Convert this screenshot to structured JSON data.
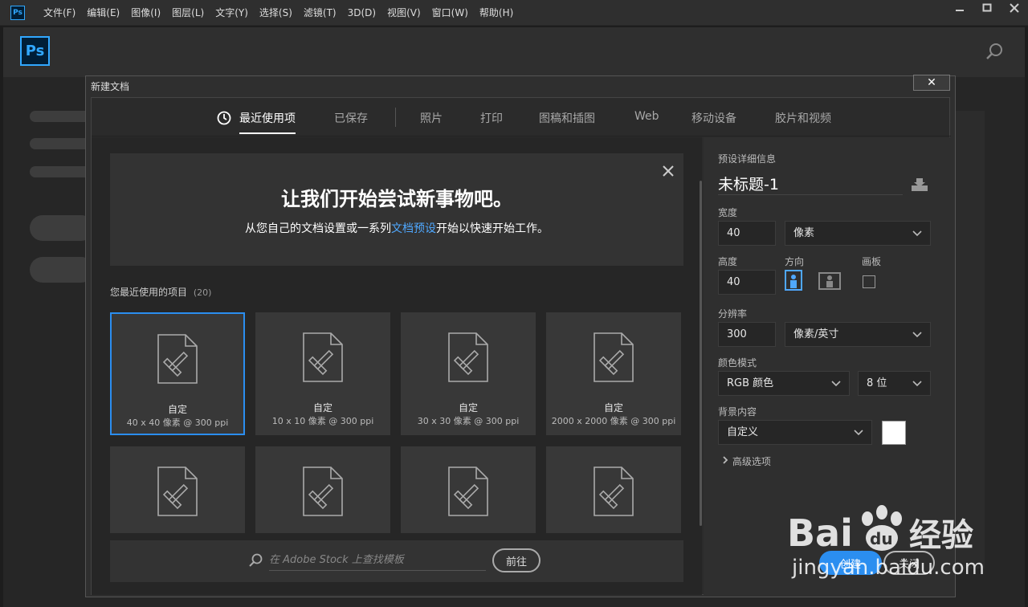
{
  "menubar": {
    "app_icon": "Ps",
    "items": [
      "文件(F)",
      "编辑(E)",
      "图像(I)",
      "图层(L)",
      "文字(Y)",
      "选择(S)",
      "滤镜(T)",
      "3D(D)",
      "视图(V)",
      "窗口(W)",
      "帮助(H)"
    ],
    "window_buttons": [
      "minimize-icon",
      "maximize-icon",
      "close-icon"
    ]
  },
  "homebar": {
    "logo": "Ps"
  },
  "dialog": {
    "title": "新建文档",
    "close_label": "✕",
    "tabs": [
      "最近使用项",
      "已保存",
      "照片",
      "打印",
      "图稿和插图",
      "Web",
      "移动设备",
      "胶片和视频"
    ],
    "active_tab": "最近使用项",
    "welcome": {
      "title": "让我们开始尝试新事物吧。",
      "subtitle_pre": "从您自己的文档设置或一系列",
      "subtitle_link": "文档预设",
      "subtitle_post": "开始以快速开始工作。"
    },
    "recent": {
      "label": "您最近使用的项目",
      "count": "(20)",
      "cards": [
        {
          "name": "自定",
          "size": "40 x 40 像素 @ 300 ppi"
        },
        {
          "name": "自定",
          "size": "10 x 10 像素 @ 300 ppi"
        },
        {
          "name": "自定",
          "size": "30 x 30 像素 @ 300 ppi"
        },
        {
          "name": "自定",
          "size": "2000 x 2000 像素 @ 300 ppi"
        }
      ]
    },
    "stock": {
      "placeholder": "在 Adobe Stock 上查找模板",
      "go_label": "前往"
    },
    "preset": {
      "header": "预设详细信息",
      "name": "未标题-1",
      "width_label": "宽度",
      "width_value": "40",
      "width_unit": "像素",
      "height_label": "高度",
      "height_value": "40",
      "orientation_label": "方向",
      "artboard_label": "画板",
      "resolution_label": "分辨率",
      "resolution_value": "300",
      "resolution_unit": "像素/英寸",
      "color_mode_label": "颜色模式",
      "color_mode": "RGB 颜色",
      "bit_depth": "8 位",
      "background_label": "背景内容",
      "background_value": "自定义",
      "background_color": "#ffffff",
      "advanced_label": "高级选项"
    },
    "create_label": "创建",
    "close_button_label": "关闭"
  },
  "watermark": {
    "brand": "Bai du 经验",
    "url": "jingyan.baidu.com"
  },
  "colors": {
    "accent": "#2b8ef0",
    "link": "#4fa8ff",
    "ps_blue": "#31a8ff"
  }
}
